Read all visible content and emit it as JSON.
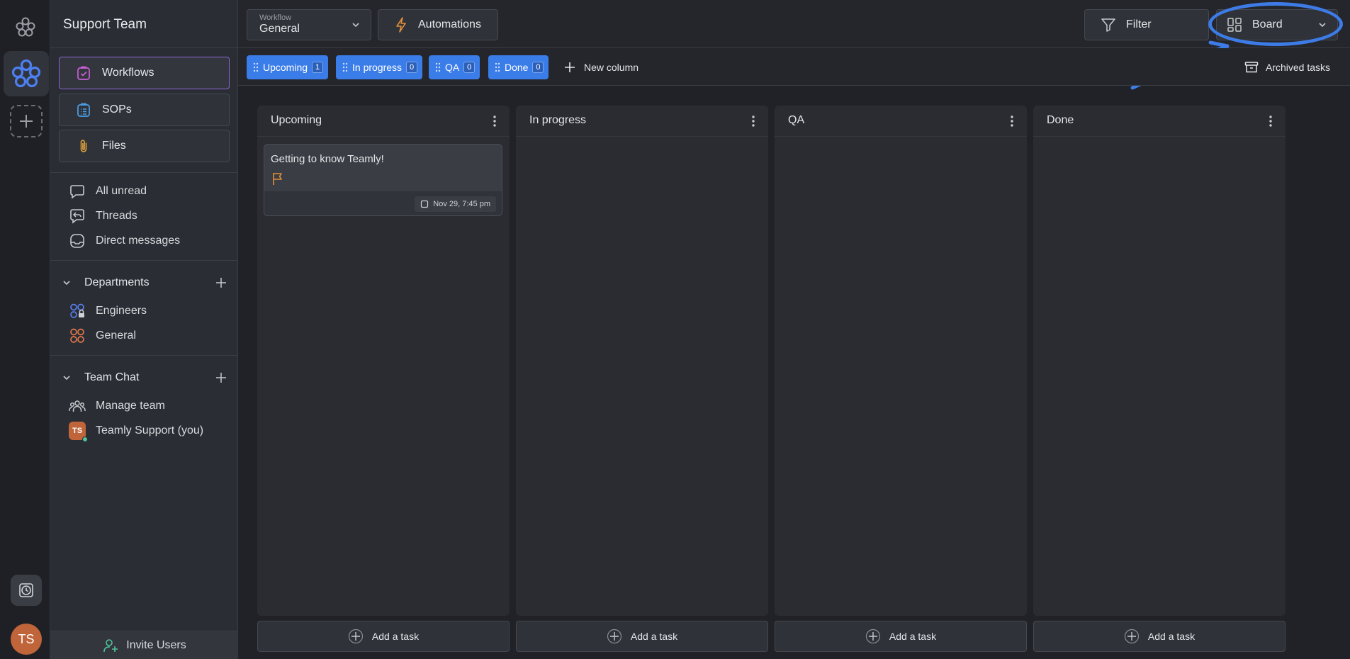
{
  "sidebar": {
    "team_name": "Support Team",
    "nav": [
      {
        "label": "Workflows",
        "icon": "workflows-icon"
      },
      {
        "label": "SOPs",
        "icon": "sop-icon"
      },
      {
        "label": "Files",
        "icon": "paperclip-icon"
      }
    ],
    "messages": [
      {
        "label": "All unread",
        "icon": "chat-bubble-icon"
      },
      {
        "label": "Threads",
        "icon": "threads-icon"
      },
      {
        "label": "Direct messages",
        "icon": "inbox-icon"
      }
    ],
    "departments": {
      "label": "Departments",
      "items": [
        {
          "label": "Engineers",
          "icon": "private-department-icon"
        },
        {
          "label": "General",
          "icon": "department-icon"
        }
      ]
    },
    "team_chat": {
      "label": "Team Chat",
      "items": [
        {
          "label": "Manage team",
          "icon": "team-icon"
        },
        {
          "label": "Teamly Support (you)",
          "avatar": "TS"
        }
      ]
    },
    "invite_label": "Invite Users"
  },
  "rail": {
    "avatar_initials": "TS"
  },
  "toolbar": {
    "workflow_label": "Workflow",
    "workflow_value": "General",
    "automations_label": "Automations",
    "filter_label": "Filter",
    "view_label": "Board"
  },
  "subbar": {
    "chips": [
      {
        "label": "Upcoming",
        "count": "1"
      },
      {
        "label": "In progress",
        "count": "0"
      },
      {
        "label": "QA",
        "count": "0"
      },
      {
        "label": "Done",
        "count": "0"
      }
    ],
    "new_column_label": "New column",
    "archived_label": "Archived tasks"
  },
  "board": {
    "columns": [
      {
        "title": "Upcoming"
      },
      {
        "title": "In progress"
      },
      {
        "title": "QA"
      },
      {
        "title": "Done"
      }
    ],
    "add_task_label": "Add a task",
    "card": {
      "title": "Getting to know Teamly!",
      "date": "Nov 29, 7:45 pm"
    }
  },
  "colors": {
    "accent_blue": "#3b7de8",
    "active_border": "#8a63d6",
    "flag": "#e0903a",
    "annotation": "#3d7be6"
  }
}
